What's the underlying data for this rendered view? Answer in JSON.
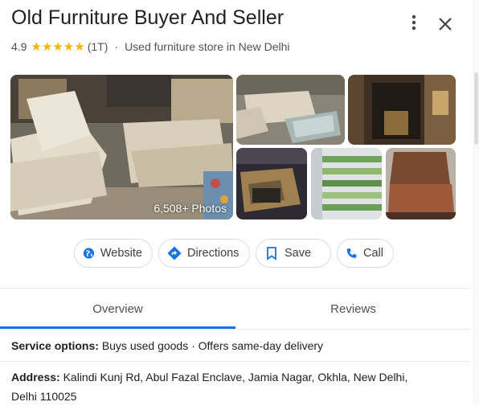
{
  "header": {
    "title": "Old Furniture Buyer And Seller",
    "rating": "4.9",
    "stars": "★★★★★",
    "review_count": "(1T)",
    "separator": "·",
    "category": "Used furniture store in New Delhi"
  },
  "icons": {
    "more": "more-vert-icon",
    "close": "close-icon",
    "website": "globe-icon",
    "directions": "directions-icon",
    "save": "bookmark-icon",
    "call": "phone-icon"
  },
  "photos": {
    "count_label": "6,508+ Photos"
  },
  "actions": {
    "website": "Website",
    "directions": "Directions",
    "save": "Save",
    "call": "Call"
  },
  "tabs": {
    "overview": "Overview",
    "reviews": "Reviews",
    "active": "Overview"
  },
  "info": {
    "service_label": "Service options:",
    "service_value": "Buys used goods · Offers same-day delivery",
    "address_label": "Address:",
    "address_value": "Kalindi Kunj Rd, Abul Fazal Enclave, Jamia Nagar, Okhla, New Delhi,",
    "address_value_2": "Delhi 110025"
  },
  "colors": {
    "accent": "#1a73e8",
    "star": "#f6b400",
    "chip_border": "#dadce0"
  }
}
